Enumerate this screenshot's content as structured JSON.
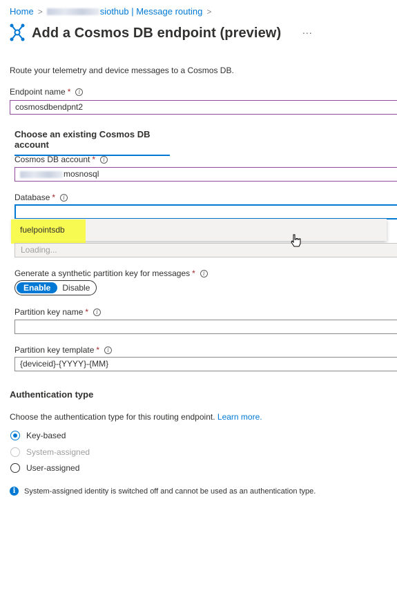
{
  "breadcrumb": {
    "home": "Home",
    "hub_suffix": "siothub | Message routing"
  },
  "header": {
    "title": "Add a Cosmos DB endpoint (preview)",
    "more": "..."
  },
  "description": "Route your telemetry and device messages to a Cosmos DB.",
  "endpoint_name": {
    "label": "Endpoint name",
    "value": "cosmosdbendpnt2"
  },
  "section_tab": "Choose an existing Cosmos DB account",
  "cosmos_account": {
    "label": "Cosmos DB account",
    "value_suffix": "mosnosql"
  },
  "database": {
    "label": "Database",
    "value": "",
    "dropdown_options": [
      "fuelpointsdb"
    ],
    "loading_text": "Loading..."
  },
  "synthetic_key": {
    "label": "Generate a synthetic partition key for messages",
    "enable": "Enable",
    "disable": "Disable"
  },
  "partition_key_name": {
    "label": "Partition key name",
    "value": ""
  },
  "partition_key_template": {
    "label": "Partition key template",
    "value": "{deviceid}-{YYYY}-{MM}"
  },
  "auth": {
    "heading": "Authentication type",
    "description": "Choose the authentication type for this routing endpoint.",
    "learn_more": "Learn more.",
    "options": [
      "Key-based",
      "System-assigned",
      "User-assigned"
    ],
    "notice": "System-assigned identity is switched off and cannot be used as an authentication type."
  },
  "colors": {
    "accent": "#0078d4",
    "required": "#a4262c",
    "highlight": "#f7fb3f"
  }
}
